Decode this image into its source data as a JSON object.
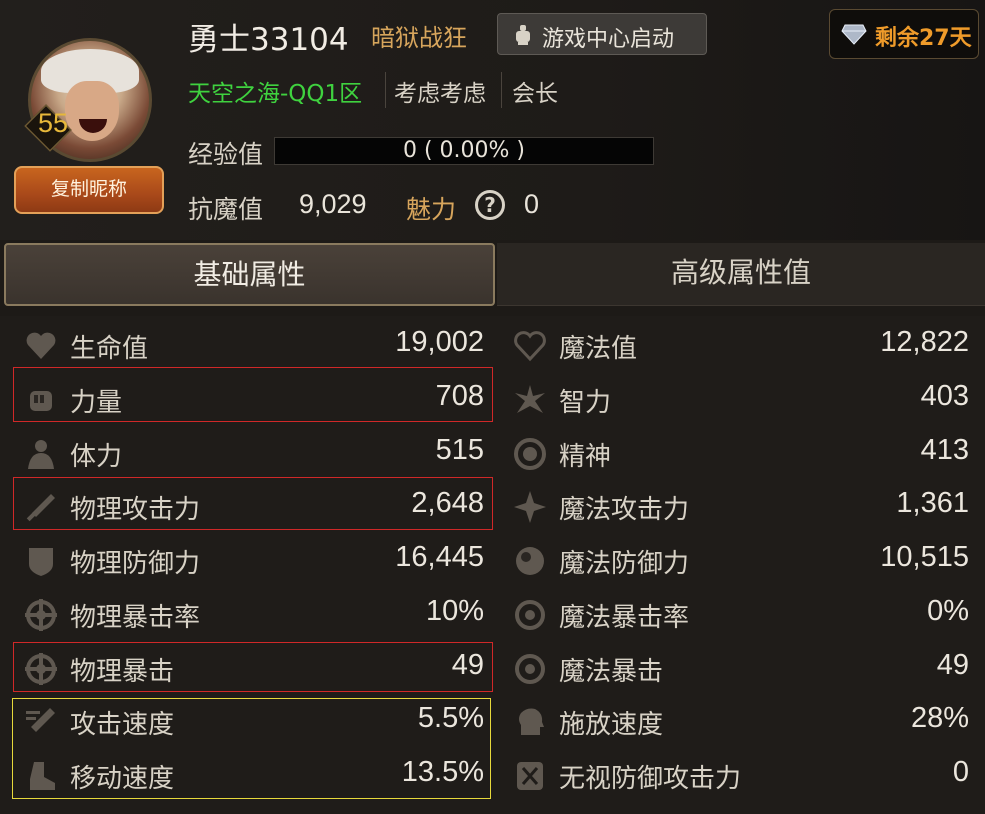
{
  "player": {
    "name": "勇士33104",
    "title": "暗狱战狂",
    "level": "55",
    "server": "天空之海-QQ1区",
    "guild": "考虑考虑",
    "role": "会长",
    "copy_button": "复制昵称"
  },
  "header": {
    "game_center_button": "游戏中心启动",
    "remaining_days": "剩余27天"
  },
  "experience": {
    "label": "经验值",
    "text": "0 ( 0.00% )",
    "progress_percent": 0
  },
  "resist": {
    "label": "抗魔值",
    "value": "9,029"
  },
  "charm": {
    "label": "魅力",
    "value": "0"
  },
  "tabs": {
    "basic": "基础属性",
    "advanced": "高级属性值"
  },
  "stats_left": [
    {
      "icon": "heart-icon",
      "label": "生命值",
      "value": "19,002"
    },
    {
      "icon": "fist-icon",
      "label": "力量",
      "value": "708"
    },
    {
      "icon": "body-icon",
      "label": "体力",
      "value": "515"
    },
    {
      "icon": "sword-icon",
      "label": "物理攻击力",
      "value": "2,648"
    },
    {
      "icon": "shield-icon",
      "label": "物理防御力",
      "value": "16,445"
    },
    {
      "icon": "crosshair-icon",
      "label": "物理暴击率",
      "value": "10%"
    },
    {
      "icon": "crosshair-icon",
      "label": "物理暴击",
      "value": "49"
    },
    {
      "icon": "attack-speed-icon",
      "label": "攻击速度",
      "value": "5.5%"
    },
    {
      "icon": "boot-icon",
      "label": "移动速度",
      "value": "13.5%"
    }
  ],
  "stats_right": [
    {
      "icon": "heart-outline-icon",
      "label": "魔法值",
      "value": "12,822"
    },
    {
      "icon": "burst-icon",
      "label": "智力",
      "value": "403"
    },
    {
      "icon": "spirit-icon",
      "label": "精神",
      "value": "413"
    },
    {
      "icon": "sparkle-icon",
      "label": "魔法攻击力",
      "value": "1,361"
    },
    {
      "icon": "orb-icon",
      "label": "魔法防御力",
      "value": "10,515"
    },
    {
      "icon": "target-ring-icon",
      "label": "魔法暴击率",
      "value": "0%"
    },
    {
      "icon": "target-ring-icon",
      "label": "魔法暴击",
      "value": "49"
    },
    {
      "icon": "head-gear-icon",
      "label": "施放速度",
      "value": "28%"
    },
    {
      "icon": "crossed-shield-icon",
      "label": "无视防御攻击力",
      "value": "0"
    }
  ],
  "colors": {
    "highlight_red": "#d02828",
    "highlight_yellow": "#e7d93b",
    "server_green": "#3fd23f",
    "title_gold": "#d7a55c",
    "remain_orange": "#ef9b2a"
  }
}
